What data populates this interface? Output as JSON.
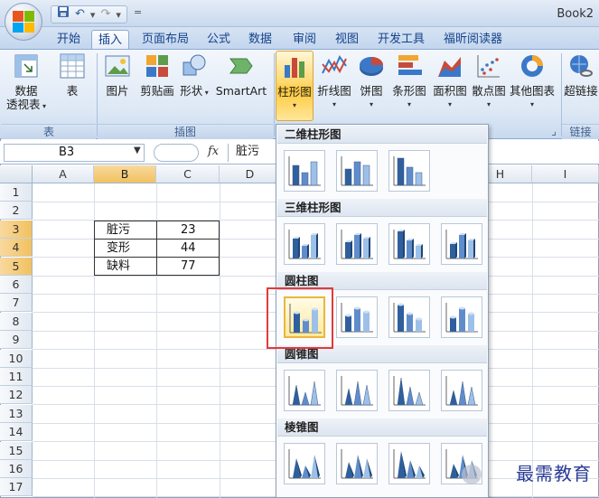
{
  "window": {
    "title": "Book2"
  },
  "quick_access": {
    "icons": [
      "save-icon",
      "undo-icon",
      "redo-icon"
    ]
  },
  "tabs": [
    {
      "label": "开始",
      "active": false
    },
    {
      "label": "插入",
      "active": true
    },
    {
      "label": "页面布局",
      "active": false
    },
    {
      "label": "公式",
      "active": false
    },
    {
      "label": "数据",
      "active": false
    },
    {
      "label": "审阅",
      "active": false
    },
    {
      "label": "视图",
      "active": false
    },
    {
      "label": "开发工具",
      "active": false
    },
    {
      "label": "福昕阅读器",
      "active": false
    }
  ],
  "ribbon": {
    "pivot": {
      "line1": "数据",
      "line2": "透视表"
    },
    "table": "表",
    "picture": "图片",
    "clipart": "剪贴画",
    "shapes": "形状",
    "smartart": "SmartArt",
    "column": "柱形图",
    "line": "折线图",
    "pie": "饼图",
    "bar": "条形图",
    "area": "面积图",
    "scatter": "散点图",
    "other": "其他图表",
    "hyperlink": "超链接",
    "groups": {
      "tables": "表",
      "illustrations": "插图",
      "links": "链接"
    }
  },
  "formula_bar": {
    "name_box": "B3",
    "fx": "fx",
    "content": "脏污"
  },
  "columns": [
    "A",
    "B",
    "C",
    "D",
    "H",
    "I"
  ],
  "rows": [
    "1",
    "2",
    "3",
    "4",
    "5",
    "6",
    "7",
    "8",
    "9",
    "10",
    "11",
    "12",
    "13",
    "14",
    "15",
    "16",
    "17"
  ],
  "cells": [
    {
      "label": "脏污",
      "value": "23"
    },
    {
      "label": "变形",
      "value": "44"
    },
    {
      "label": "缺料",
      "value": "77"
    }
  ],
  "gallery": {
    "sections": {
      "2d_column": "二维柱形图",
      "3d_column": "三维柱形图",
      "cylinder": "圆柱图",
      "cone": "圆锥图",
      "pyramid": "棱锥图"
    }
  },
  "watermark": "最需教育",
  "colors": {
    "accent": "#15428b",
    "highlight": "#ffc93a",
    "red_box": "#e23a3a"
  }
}
